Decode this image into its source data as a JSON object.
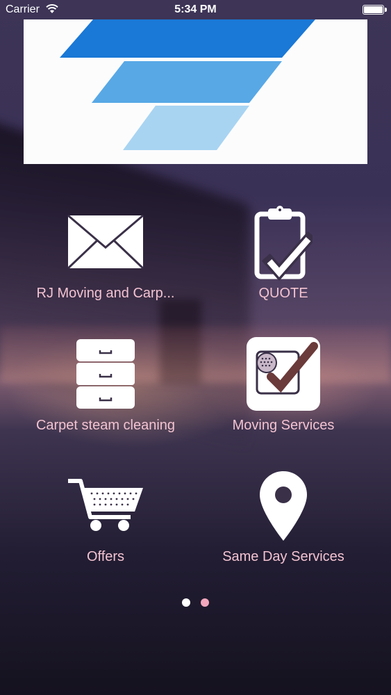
{
  "status_bar": {
    "carrier": "Carrier",
    "time": "5:34 PM"
  },
  "banner": {
    "logo_colors": [
      "#1a78d6",
      "#58a8e6",
      "#a8d4f2"
    ]
  },
  "tiles": [
    {
      "label": "RJ Moving and Carp...",
      "icon": "envelope-icon"
    },
    {
      "label": "QUOTE",
      "icon": "clipboard-check-icon"
    },
    {
      "label": "Carpet steam cleaning",
      "icon": "file-cabinet-icon"
    },
    {
      "label": "Moving Services",
      "icon": "checklist-checkbox-icon"
    },
    {
      "label": "Offers",
      "icon": "shopping-cart-icon"
    },
    {
      "label": "Same Day Services",
      "icon": "map-pin-icon"
    }
  ],
  "pager": {
    "total_pages": 2,
    "active_page": 1,
    "active_color": "#ffffff",
    "inactive_color": "#f2a7bd"
  },
  "colors": {
    "label_color": "#f3c3d1",
    "icon_color": "#ffffff"
  }
}
